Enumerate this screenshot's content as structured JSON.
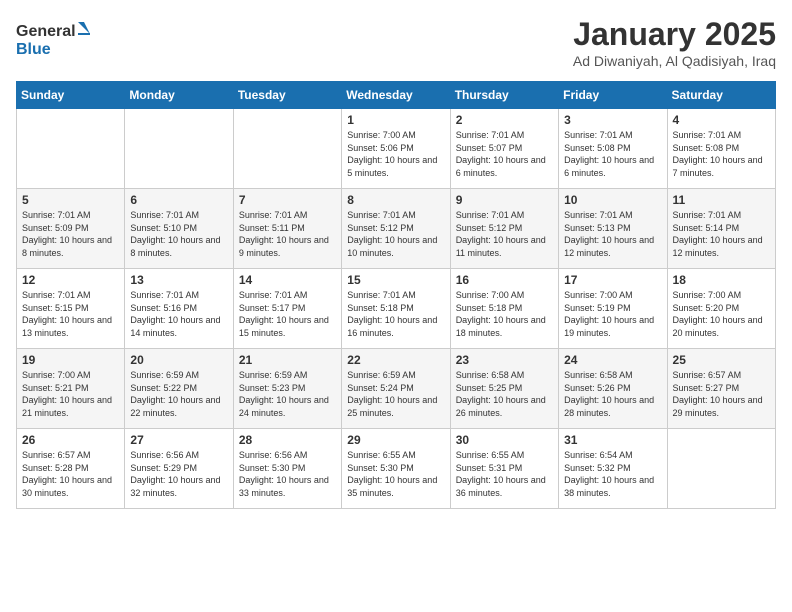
{
  "logo": {
    "line1": "General",
    "line2": "Blue"
  },
  "title": "January 2025",
  "subtitle": "Ad Diwaniyah, Al Qadisiyah, Iraq",
  "days_of_week": [
    "Sunday",
    "Monday",
    "Tuesday",
    "Wednesday",
    "Thursday",
    "Friday",
    "Saturday"
  ],
  "weeks": [
    [
      {
        "num": "",
        "sunrise": "",
        "sunset": "",
        "daylight": ""
      },
      {
        "num": "",
        "sunrise": "",
        "sunset": "",
        "daylight": ""
      },
      {
        "num": "",
        "sunrise": "",
        "sunset": "",
        "daylight": ""
      },
      {
        "num": "1",
        "sunrise": "7:00 AM",
        "sunset": "5:06 PM",
        "daylight": "10 hours and 5 minutes."
      },
      {
        "num": "2",
        "sunrise": "7:01 AM",
        "sunset": "5:07 PM",
        "daylight": "10 hours and 6 minutes."
      },
      {
        "num": "3",
        "sunrise": "7:01 AM",
        "sunset": "5:08 PM",
        "daylight": "10 hours and 6 minutes."
      },
      {
        "num": "4",
        "sunrise": "7:01 AM",
        "sunset": "5:08 PM",
        "daylight": "10 hours and 7 minutes."
      }
    ],
    [
      {
        "num": "5",
        "sunrise": "7:01 AM",
        "sunset": "5:09 PM",
        "daylight": "10 hours and 8 minutes."
      },
      {
        "num": "6",
        "sunrise": "7:01 AM",
        "sunset": "5:10 PM",
        "daylight": "10 hours and 8 minutes."
      },
      {
        "num": "7",
        "sunrise": "7:01 AM",
        "sunset": "5:11 PM",
        "daylight": "10 hours and 9 minutes."
      },
      {
        "num": "8",
        "sunrise": "7:01 AM",
        "sunset": "5:12 PM",
        "daylight": "10 hours and 10 minutes."
      },
      {
        "num": "9",
        "sunrise": "7:01 AM",
        "sunset": "5:12 PM",
        "daylight": "10 hours and 11 minutes."
      },
      {
        "num": "10",
        "sunrise": "7:01 AM",
        "sunset": "5:13 PM",
        "daylight": "10 hours and 12 minutes."
      },
      {
        "num": "11",
        "sunrise": "7:01 AM",
        "sunset": "5:14 PM",
        "daylight": "10 hours and 12 minutes."
      }
    ],
    [
      {
        "num": "12",
        "sunrise": "7:01 AM",
        "sunset": "5:15 PM",
        "daylight": "10 hours and 13 minutes."
      },
      {
        "num": "13",
        "sunrise": "7:01 AM",
        "sunset": "5:16 PM",
        "daylight": "10 hours and 14 minutes."
      },
      {
        "num": "14",
        "sunrise": "7:01 AM",
        "sunset": "5:17 PM",
        "daylight": "10 hours and 15 minutes."
      },
      {
        "num": "15",
        "sunrise": "7:01 AM",
        "sunset": "5:18 PM",
        "daylight": "10 hours and 16 minutes."
      },
      {
        "num": "16",
        "sunrise": "7:00 AM",
        "sunset": "5:18 PM",
        "daylight": "10 hours and 18 minutes."
      },
      {
        "num": "17",
        "sunrise": "7:00 AM",
        "sunset": "5:19 PM",
        "daylight": "10 hours and 19 minutes."
      },
      {
        "num": "18",
        "sunrise": "7:00 AM",
        "sunset": "5:20 PM",
        "daylight": "10 hours and 20 minutes."
      }
    ],
    [
      {
        "num": "19",
        "sunrise": "7:00 AM",
        "sunset": "5:21 PM",
        "daylight": "10 hours and 21 minutes."
      },
      {
        "num": "20",
        "sunrise": "6:59 AM",
        "sunset": "5:22 PM",
        "daylight": "10 hours and 22 minutes."
      },
      {
        "num": "21",
        "sunrise": "6:59 AM",
        "sunset": "5:23 PM",
        "daylight": "10 hours and 24 minutes."
      },
      {
        "num": "22",
        "sunrise": "6:59 AM",
        "sunset": "5:24 PM",
        "daylight": "10 hours and 25 minutes."
      },
      {
        "num": "23",
        "sunrise": "6:58 AM",
        "sunset": "5:25 PM",
        "daylight": "10 hours and 26 minutes."
      },
      {
        "num": "24",
        "sunrise": "6:58 AM",
        "sunset": "5:26 PM",
        "daylight": "10 hours and 28 minutes."
      },
      {
        "num": "25",
        "sunrise": "6:57 AM",
        "sunset": "5:27 PM",
        "daylight": "10 hours and 29 minutes."
      }
    ],
    [
      {
        "num": "26",
        "sunrise": "6:57 AM",
        "sunset": "5:28 PM",
        "daylight": "10 hours and 30 minutes."
      },
      {
        "num": "27",
        "sunrise": "6:56 AM",
        "sunset": "5:29 PM",
        "daylight": "10 hours and 32 minutes."
      },
      {
        "num": "28",
        "sunrise": "6:56 AM",
        "sunset": "5:30 PM",
        "daylight": "10 hours and 33 minutes."
      },
      {
        "num": "29",
        "sunrise": "6:55 AM",
        "sunset": "5:30 PM",
        "daylight": "10 hours and 35 minutes."
      },
      {
        "num": "30",
        "sunrise": "6:55 AM",
        "sunset": "5:31 PM",
        "daylight": "10 hours and 36 minutes."
      },
      {
        "num": "31",
        "sunrise": "6:54 AM",
        "sunset": "5:32 PM",
        "daylight": "10 hours and 38 minutes."
      },
      {
        "num": "",
        "sunrise": "",
        "sunset": "",
        "daylight": ""
      }
    ]
  ]
}
